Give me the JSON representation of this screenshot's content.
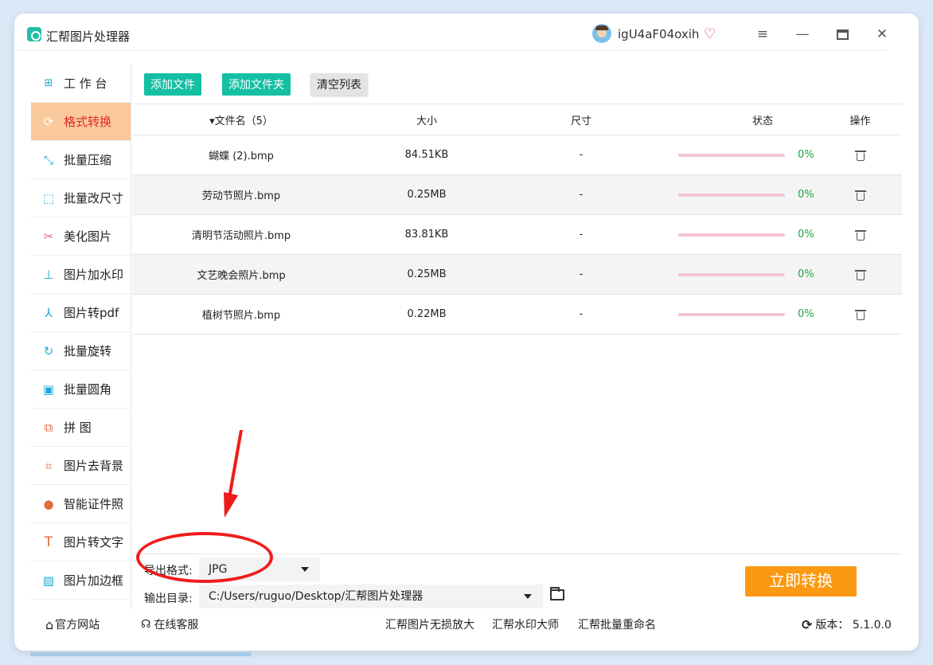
{
  "titlebar": {
    "app_title": "汇帮图片处理器",
    "username": "igU4aF04oxih",
    "icons": [
      "app-logo-icon",
      "avatar",
      "vip-heart-icon",
      "menu-icon",
      "minimize-icon",
      "maximize-icon",
      "close-icon"
    ]
  },
  "sidebar": {
    "items": [
      {
        "label": "工 作 台",
        "icon": "grid-icon"
      },
      {
        "label": "格式转换",
        "icon": "convert-icon"
      },
      {
        "label": "批量压缩",
        "icon": "compress-icon"
      },
      {
        "label": "批量改尺寸",
        "icon": "resize-icon"
      },
      {
        "label": "美化图片",
        "icon": "beautify-icon"
      },
      {
        "label": "图片加水印",
        "icon": "stamp-icon"
      },
      {
        "label": "图片转pdf",
        "icon": "pdf-icon"
      },
      {
        "label": "批量旋转",
        "icon": "rotate-icon"
      },
      {
        "label": "批量圆角",
        "icon": "rounded-image-icon"
      },
      {
        "label": "拼    图",
        "icon": "collage-icon"
      },
      {
        "label": "图片去背景",
        "icon": "crop-icon"
      },
      {
        "label": "智能证件照",
        "icon": "person-icon"
      },
      {
        "label": "图片转文字",
        "icon": "text-icon"
      },
      {
        "label": "图片加边框",
        "icon": "frame-icon"
      }
    ],
    "active_index": 1
  },
  "toolbar": {
    "add_file": "添加文件",
    "add_folder": "添加文件夹",
    "clear_list": "清空列表"
  },
  "table": {
    "headers": {
      "name": "▾文件名（5）",
      "size": "大小",
      "dimension": "尺寸",
      "status": "状态",
      "op": "操作"
    },
    "rows": [
      {
        "name": "蝴蝶 (2).bmp",
        "size": "84.51KB",
        "dimension": "-",
        "progress": "0%"
      },
      {
        "name": "劳动节照片.bmp",
        "size": "0.25MB",
        "dimension": "-",
        "progress": "0%"
      },
      {
        "name": "清明节活动照片.bmp",
        "size": "83.81KB",
        "dimension": "-",
        "progress": "0%"
      },
      {
        "name": "文艺晚会照片.bmp",
        "size": "0.25MB",
        "dimension": "-",
        "progress": "0%"
      },
      {
        "name": "植树节照片.bmp",
        "size": "0.22MB",
        "dimension": "-",
        "progress": "0%"
      }
    ]
  },
  "settings": {
    "format_label": "导出格式:",
    "format_value": "JPG",
    "dir_label": "输出目录:",
    "dir_value": "C:/Users/ruguo/Desktop/汇帮图片处理器",
    "convert_button": "立即转换"
  },
  "footer": {
    "website": "官方网站",
    "support": "在线客服",
    "link1": "汇帮图片无损放大",
    "link2": "汇帮水印大师",
    "link3": "汇帮批量重命名",
    "version": "版本：  5.1.0.0"
  },
  "colors": {
    "accent_teal": "#13c0a4",
    "active_bg": "#f9c99c",
    "active_text": "#e02b1d",
    "convert_orange": "#fb9a12",
    "progress_green": "#22a53c",
    "annotation_red": "#ef1c1c"
  }
}
